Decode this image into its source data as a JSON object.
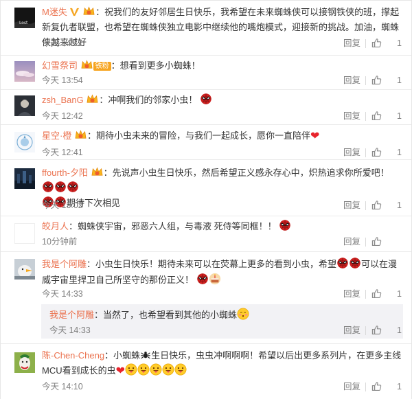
{
  "labels": {
    "reply": "回复"
  },
  "comments": [
    {
      "user": "M迷失",
      "text": "：祝我们的友好邻居生日快乐，我希望在未来蜘蛛侠可以接钢铁侠的班，撑起新复仇者联盟，也希望在蜘蛛侠独立电影中继续他的嘴炮模式，迎接新的挑战。加油，蜘蛛侠越来越好",
      "time": "今天 14:12",
      "likes": "1",
      "badges": [
        "verified-v-icon",
        "vip-level-icon"
      ]
    },
    {
      "user": "幻雪祭司",
      "text": "：想看到更多小蜘蛛！",
      "time": "今天 13:54",
      "likes": "1",
      "badges": [
        "vip-level-icon",
        "fan-badge"
      ],
      "fan_badge": "铁粉"
    },
    {
      "user": "zsh_BanG",
      "text": "：冲啊我们的邻家小虫！",
      "time": "今天 12:42",
      "likes": "1",
      "badges": [
        "vip-level-icon"
      ],
      "emoji": [
        "spiderman-emoji"
      ]
    },
    {
      "user": "星空·橙",
      "text": "：期待小虫未来的冒险，与我们一起成长，愿你一直陪伴",
      "time": "今天 12:41",
      "likes": "1",
      "badges": [
        "vip-level-icon"
      ],
      "emoji": [
        "heart-emoji"
      ]
    },
    {
      "user": "ffourth-夕阳",
      "text": "：先说声小虫生日快乐，然后希望正义感永存心中，炽热追求你所爱吧！",
      "text2": "期待下次相见",
      "time": "今天 13:02",
      "likes": "1",
      "badges": [
        "vip-level-icon"
      ]
    },
    {
      "user": "皎月人",
      "text": "：蜘蛛侠宇宙，邪恶六人组，与毒液 死侍等同框！！",
      "time": "10分钟前",
      "likes": "",
      "badges": []
    },
    {
      "user": "我是个阿雕",
      "text_a": "：小虫生日快乐！期待未来可以在荧幕上更多的看到小虫，希望",
      "text_b": "可以在漫威宇宙里捍卫自己所坚守的那份正义！",
      "time": "今天 14:33",
      "likes": "1",
      "badges": [],
      "reply": {
        "user": "我是个阿雕",
        "text": "：当然了，也希望看到其他的小蜘蛛",
        "time": "今天 14:33",
        "likes": "1"
      }
    },
    {
      "user": "陈-Chen-Cheng",
      "text_a": "：小蜘蛛",
      "text_b": "生日快乐，虫虫冲啊啊啊！希望以后出更多系列片，在更多主线MCU看到成长的虫",
      "time": "今天 14:10",
      "likes": "1",
      "badges": []
    }
  ],
  "colors": {
    "username": "#eb7350",
    "meta": "#808080",
    "reply_bg": "#f2f2f5",
    "verified": "#f5a623",
    "vip": "#f6a81d"
  }
}
